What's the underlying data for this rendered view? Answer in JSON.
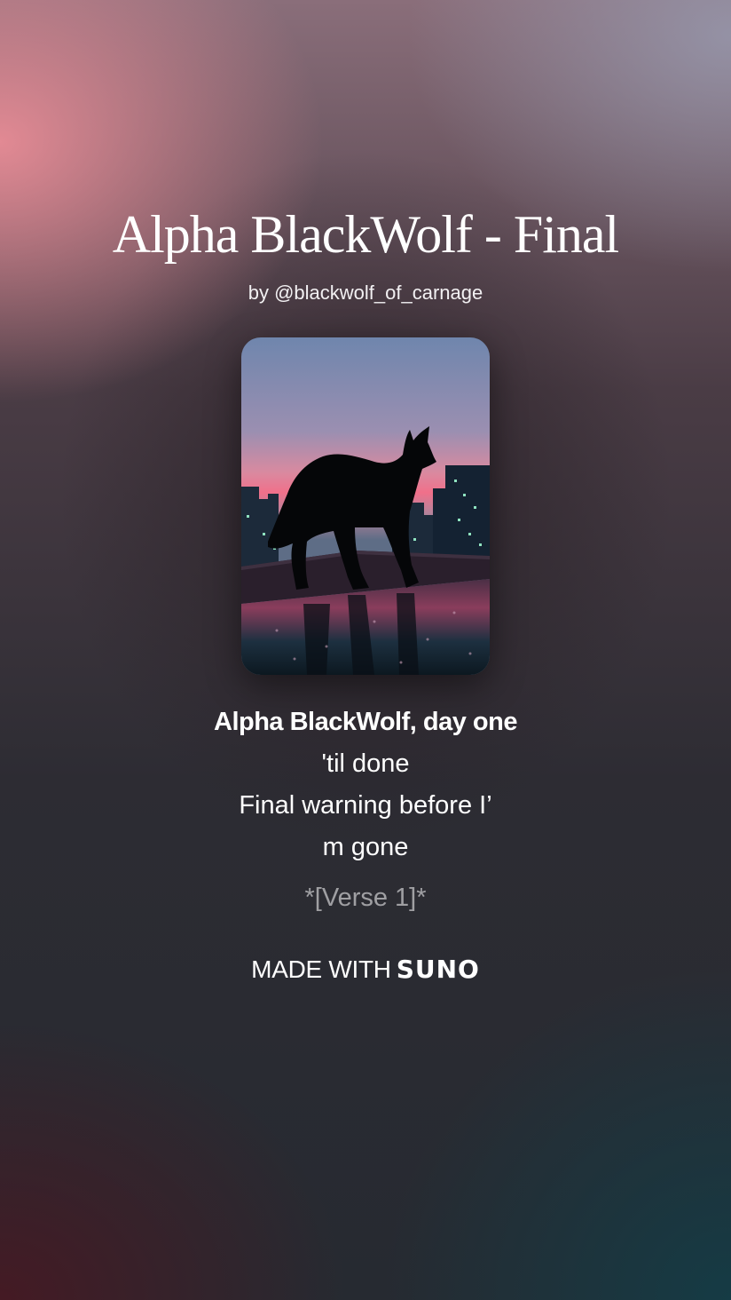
{
  "song": {
    "title": "Alpha BlackWolf - Final",
    "byline": "by @blackwolf_of_carnage"
  },
  "cover": {
    "icon": "wolf-silhouette-rooftop-artwork"
  },
  "lyrics": {
    "active": "Alpha BlackWolf, day one",
    "lines": [
      "'til done",
      "Final warning before I’",
      "m gone"
    ],
    "next_section": "*[Verse 1]*"
  },
  "footer": {
    "made_with": "MADE WITH",
    "brand": "SUNO"
  },
  "colors": {
    "top_left_glow": "#e88c96",
    "bottom_right_glow": "#143c46",
    "text": "#ffffff"
  }
}
